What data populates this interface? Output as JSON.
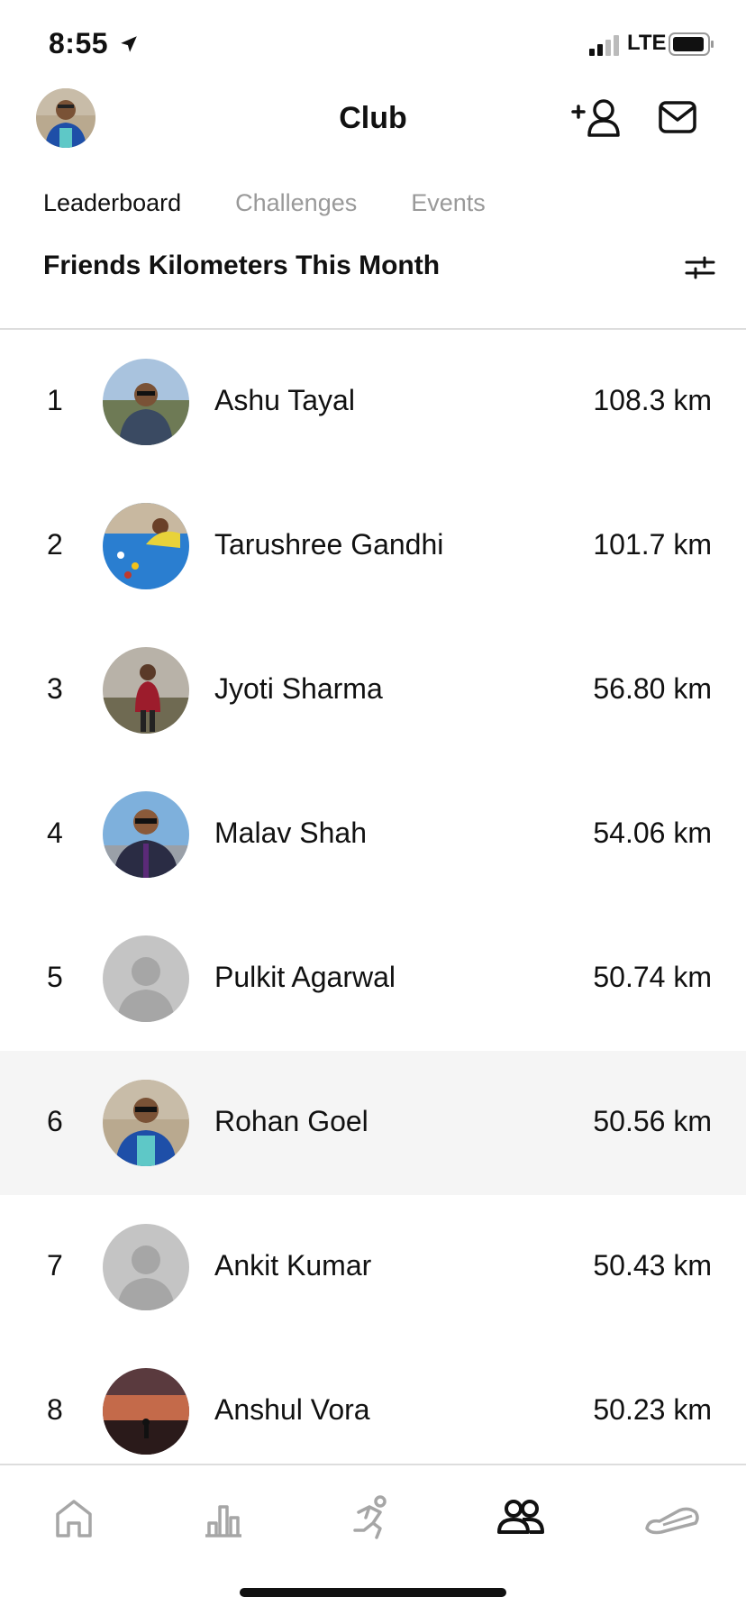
{
  "status": {
    "time": "8:55",
    "network": "LTE"
  },
  "header": {
    "title": "Club"
  },
  "tabs": [
    {
      "label": "Leaderboard",
      "active": true
    },
    {
      "label": "Challenges",
      "active": false
    },
    {
      "label": "Events",
      "active": false
    }
  ],
  "section_title": "Friends Kilometers This Month",
  "leaderboard": [
    {
      "rank": "1",
      "name": "Ashu Tayal",
      "distance": "108.3 km"
    },
    {
      "rank": "2",
      "name": "Tarushree Gandhi",
      "distance": "101.7 km"
    },
    {
      "rank": "3",
      "name": "Jyoti Sharma",
      "distance": "56.80 km"
    },
    {
      "rank": "4",
      "name": "Malav Shah",
      "distance": "54.06 km"
    },
    {
      "rank": "5",
      "name": "Pulkit Agarwal",
      "distance": "50.74 km"
    },
    {
      "rank": "6",
      "name": "Rohan Goel",
      "distance": "50.56 km"
    },
    {
      "rank": "7",
      "name": "Ankit Kumar",
      "distance": "50.43 km"
    },
    {
      "rank": "8",
      "name": "Anshul Vora",
      "distance": "50.23 km"
    }
  ],
  "tabbar": {
    "items": [
      "home-icon",
      "activity-icon",
      "run-icon",
      "club-icon",
      "shoe-icon"
    ],
    "active": "club-icon"
  },
  "colors": {
    "highlight_row": "#f5f5f5",
    "inactive": "#999999",
    "active": "#111111"
  }
}
